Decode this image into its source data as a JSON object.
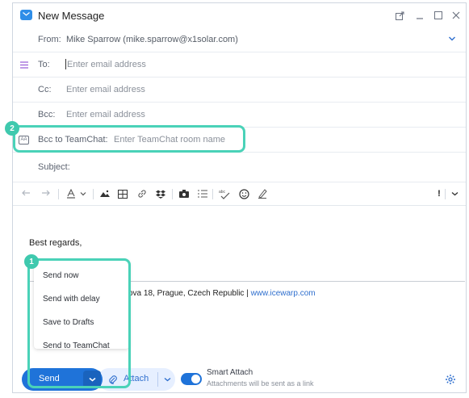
{
  "window": {
    "title": "New Message"
  },
  "from": {
    "label": "From:",
    "value": "Mike Sparrow (mike.sparrow@x1solar.com)"
  },
  "to": {
    "label": "To:",
    "placeholder": "Enter email address"
  },
  "cc": {
    "label": "Cc:",
    "placeholder": "Enter email address"
  },
  "bcc": {
    "label": "Bcc:",
    "placeholder": "Enter email address"
  },
  "bcc_teamchat": {
    "label": "Bcc to TeamChat:",
    "placeholder": "Enter TeamChat room name",
    "icon_text": "AA"
  },
  "subject": {
    "label": "Subject:"
  },
  "editor": {
    "signature": "Best regards,",
    "address_visible": "ova 18, Prague, Czech Republic | ",
    "website": "www.icewarp.com"
  },
  "send_menu": {
    "items": [
      "Send now",
      "Send with delay",
      "Save to Drafts",
      "Send to TeamChat"
    ]
  },
  "footer": {
    "send_label": "Send",
    "attach_label": "Attach",
    "smart_attach_title": "Smart Attach",
    "smart_attach_subtitle": "Attachments will be sent as a link"
  },
  "badges": {
    "one": "1",
    "two": "2"
  },
  "toolbar": {
    "priority": "!"
  },
  "colors": {
    "accent": "#1f73d9",
    "highlight": "#4ad2b8",
    "badge": "#3fc9ae",
    "link": "#2f6fce"
  }
}
